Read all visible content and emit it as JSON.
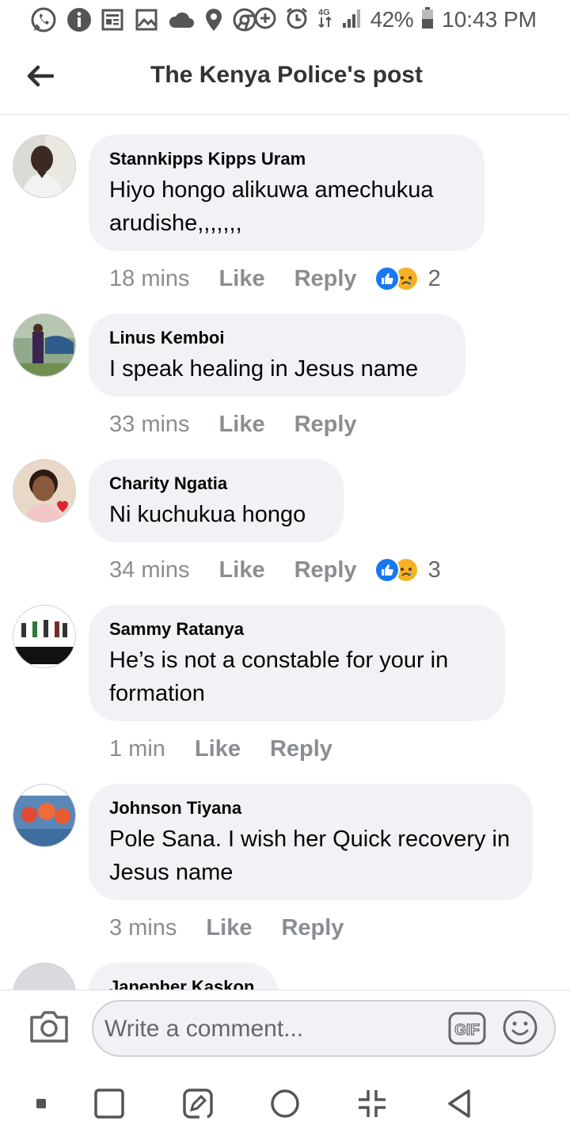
{
  "status_bar": {
    "battery": "42%",
    "time": "10:43 PM",
    "network": "4G"
  },
  "header": {
    "title": "The Kenya Police's post"
  },
  "comments": [
    {
      "author": "Stannkipps Kipps Uram",
      "text": "Hiyo hongo alikuwa amechukua arudishe,,,,,,,",
      "time": "18 mins",
      "like_label": "Like",
      "reply_label": "Reply",
      "reaction_count": "2"
    },
    {
      "author": "Linus Kemboi",
      "text": "I speak healing in Jesus name",
      "time": "33 mins",
      "like_label": "Like",
      "reply_label": "Reply"
    },
    {
      "author": "Charity Ngatia",
      "text": "Ni kuchukua hongo",
      "time": "34 mins",
      "like_label": "Like",
      "reply_label": "Reply",
      "reaction_count": "3"
    },
    {
      "author": "Sammy Ratanya",
      "text": "He’s is not a constable for your in formation",
      "time": "1 min",
      "like_label": "Like",
      "reply_label": "Reply"
    },
    {
      "author": "Johnson Tiyana",
      "text": "Pole Sana. I wish her Quick recovery in Jesus name",
      "time": "3 mins",
      "like_label": "Like",
      "reply_label": "Reply"
    },
    {
      "author": "Janepher Kaskon"
    }
  ],
  "composer": {
    "placeholder": "Write a comment...",
    "gif_label": "GIF"
  },
  "colors": {
    "bubble": "#f0f2f5",
    "meta_text": "#8a8d91",
    "like_blue": "#1877f2",
    "sad_yellow": "#f7b125"
  },
  "icons": {
    "status_left": [
      "whatsapp-icon",
      "info-icon",
      "news-icon",
      "image-icon",
      "cloud-icon",
      "location-icon",
      "chrome-icon"
    ],
    "status_right": [
      "data-saver-icon",
      "alarm-icon",
      "network-icon",
      "signal-icon",
      "battery-icon"
    ],
    "nav": [
      "dot-icon",
      "recents-icon",
      "edit-icon",
      "home-icon",
      "shrink-icon",
      "back-icon"
    ]
  }
}
